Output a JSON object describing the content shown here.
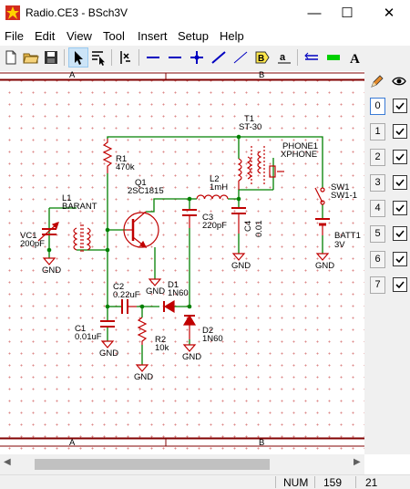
{
  "window": {
    "title": "Radio.CE3 - BSch3V",
    "minimize": "—",
    "maximize": "☐",
    "close": "✕"
  },
  "menu": [
    "File",
    "Edit",
    "View",
    "Tool",
    "Insert",
    "Setup",
    "Help"
  ],
  "toolbar": {
    "icons": [
      "new-file-icon",
      "open-file-icon",
      "save-icon",
      "select-arrow-icon",
      "drag-select-icon",
      "tag-tool-icon",
      "wire-icon",
      "bus-icon",
      "junction-icon",
      "dash-line-icon",
      "thin-line-icon",
      "label-icon",
      "comment-icon",
      "entry-icon",
      "component-icon",
      "text-icon"
    ],
    "label_letters": {
      "label": "B",
      "comment": "a",
      "text": "A"
    }
  },
  "schematic": {
    "frame_columns_top": [
      "A",
      "B"
    ],
    "frame_columns_bottom": [
      "A",
      "B"
    ],
    "components": [
      {
        "ref": "T1",
        "value": "ST-30"
      },
      {
        "ref": "PHONE1",
        "value": "XPHONE"
      },
      {
        "ref": "R1",
        "value": "470k"
      },
      {
        "ref": "Q1",
        "value": "2SC1815"
      },
      {
        "ref": "L2",
        "value": "1mH"
      },
      {
        "ref": "L1",
        "value": "BARANT"
      },
      {
        "ref": "SW1",
        "value": "SW1-1"
      },
      {
        "ref": "C3",
        "value": "220pF"
      },
      {
        "ref": "C4",
        "value": "0.01"
      },
      {
        "ref": "VC1",
        "value": "200pF"
      },
      {
        "ref": "BATT1",
        "value": "3V"
      },
      {
        "ref": "C2",
        "value": "0.22uF"
      },
      {
        "ref": "D1",
        "value": "1N60"
      },
      {
        "ref": "C1",
        "value": "0.01uF"
      },
      {
        "ref": "R2",
        "value": "10k"
      },
      {
        "ref": "D2",
        "value": "1N60"
      }
    ],
    "gnd_label": "GND"
  },
  "layers": {
    "header_icons": [
      "pencil-icon",
      "eye-icon"
    ],
    "rows": [
      {
        "num": "0",
        "visible": true,
        "selected": true
      },
      {
        "num": "1",
        "visible": true,
        "selected": false
      },
      {
        "num": "2",
        "visible": true,
        "selected": false
      },
      {
        "num": "3",
        "visible": true,
        "selected": false
      },
      {
        "num": "4",
        "visible": true,
        "selected": false
      },
      {
        "num": "5",
        "visible": true,
        "selected": false
      },
      {
        "num": "6",
        "visible": true,
        "selected": false
      },
      {
        "num": "7",
        "visible": true,
        "selected": false
      }
    ]
  },
  "statusbar": {
    "mode": "NUM",
    "x": "159",
    "y": "21"
  },
  "colors": {
    "wire": "#008000",
    "part": "#c00000",
    "frame": "#800000",
    "junction": "#008000"
  }
}
